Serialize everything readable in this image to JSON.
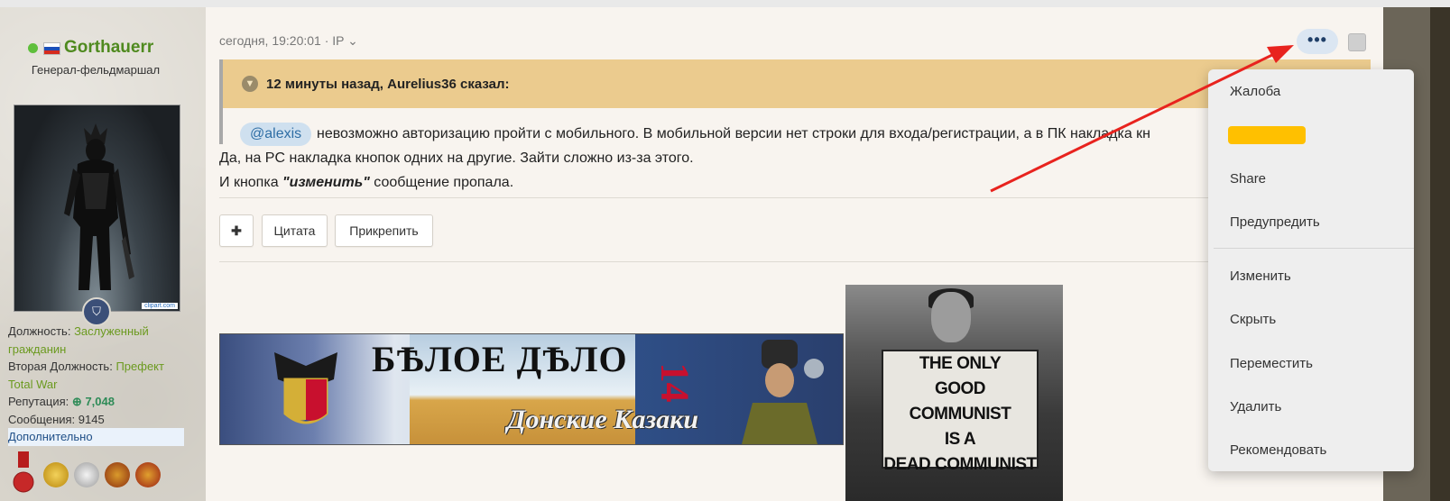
{
  "author": {
    "username": "Gorthauerr",
    "title": "Генерал-фельдмаршал",
    "info": {
      "position_label": "Должность:",
      "position_value_1": "Заслуженный",
      "position_value_2": "гражданин",
      "second_position_label": "Вторая Должность:",
      "second_position_value_1": "Префект",
      "second_position_value_2": "Total War",
      "reputation_label": "Репутация:",
      "reputation_value": "7,048",
      "messages_label": "Сообщения:",
      "messages_value": "9145",
      "more_label": "Дополнительно"
    },
    "avatar_watermark": "clipart.com"
  },
  "post": {
    "timestamp": "сегодня, 19:20:01",
    "ip_label": "IP",
    "options_button": "•••",
    "quote": {
      "header": "12 минуты назад, Aurelius36 сказал:",
      "mention": "@alexis",
      "text": "невозможно авторизацию пройти с мобильного. В мобильной версии нет строки для входа/регистрации, а в ПК накладка кн"
    },
    "body_line1": "Да, на PC накладка кнопок одних на другие. Зайти сложно из-за этого.",
    "body_line2_prefix": "И кнопка ",
    "body_line2_emph": "\"изменить\"",
    "body_line2_suffix": " сообщение пропала.",
    "buttons": {
      "plus": "✚",
      "quote": "Цитата",
      "attach": "Прикрепить"
    }
  },
  "signature": {
    "banner_title": "БѢЛОЕ ДѢЛО",
    "banner_subtitle": "Донские Казаки",
    "banner_number": "14",
    "sign_lines": [
      "THE ONLY",
      "GOOD COMMUNIST",
      "IS A",
      "DEAD COMMUNIST"
    ]
  },
  "menu": {
    "items": [
      "Жалоба",
      "Share",
      "Предупредить",
      "Изменить",
      "Скрыть",
      "Переместить",
      "Удалить",
      "Рекомендовать"
    ]
  },
  "colors": {
    "username": "#4f8a1f",
    "quote_header_bg": "#ebcb8e",
    "mention_bg": "#cfe0ef",
    "options_button_bg": "#dbe6f2",
    "redaction": "#ffc000",
    "annotation_arrow": "#e8231e"
  }
}
